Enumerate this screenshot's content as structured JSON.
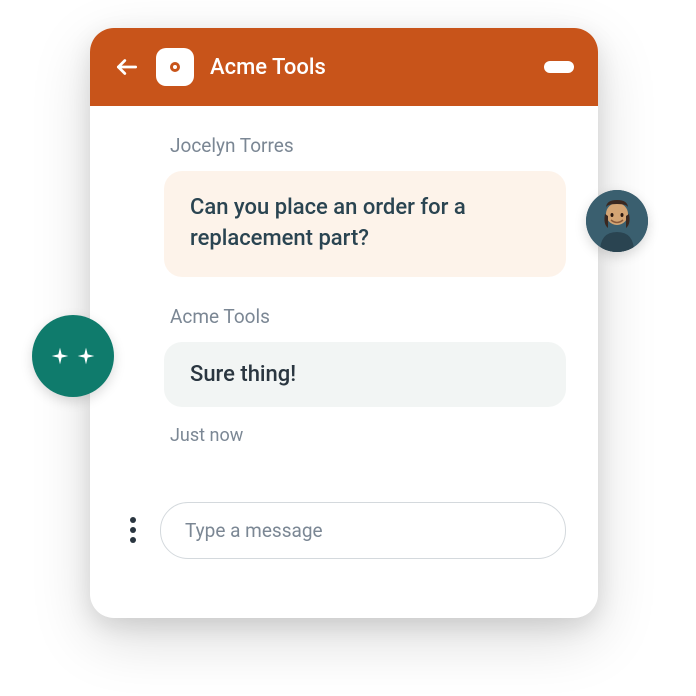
{
  "header": {
    "title": "Acme Tools"
  },
  "messages": {
    "user": {
      "sender": "Jocelyn Torres",
      "text": "Can you place an order for a replacement part?"
    },
    "agent": {
      "sender": "Acme Tools",
      "text": "Sure thing!"
    },
    "timestamp": "Just now"
  },
  "input": {
    "placeholder": "Type a message"
  }
}
